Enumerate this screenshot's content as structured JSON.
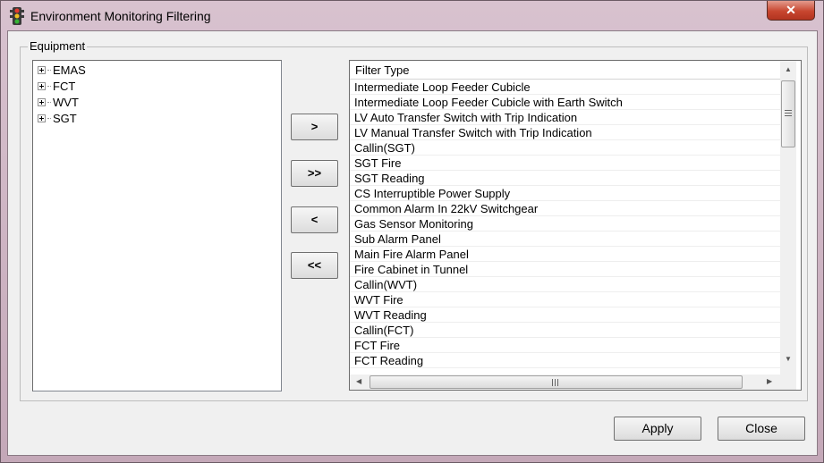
{
  "window": {
    "title": "Environment Monitoring Filtering",
    "close_glyph": "✕"
  },
  "equipment": {
    "label": "Equipment",
    "tree": [
      "EMAS",
      "FCT",
      "WVT",
      "SGT"
    ]
  },
  "move_buttons": {
    "add": ">",
    "add_all": ">>",
    "remove": "<",
    "remove_all": "<<"
  },
  "filter_list": {
    "header": "Filter Type",
    "rows": [
      "Intermediate Loop Feeder Cubicle",
      "Intermediate Loop Feeder Cubicle with Earth Switch",
      "LV Auto Transfer Switch with Trip Indication",
      "LV Manual Transfer Switch with Trip Indication",
      "Callin(SGT)",
      "SGT Fire",
      "SGT Reading",
      "CS Interruptible Power Supply",
      "Common Alarm In 22kV Switchgear",
      "Gas Sensor Monitoring",
      "Sub Alarm Panel",
      "Main Fire Alarm Panel",
      "Fire Cabinet in Tunnel",
      "Callin(WVT)",
      "WVT Fire",
      "WVT Reading",
      "Callin(FCT)",
      "FCT Fire",
      "FCT Reading"
    ]
  },
  "footer": {
    "apply": "Apply",
    "close": "Close"
  }
}
